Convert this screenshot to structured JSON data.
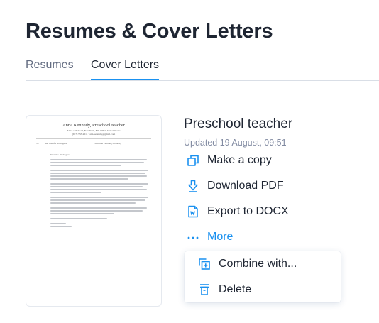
{
  "page": {
    "title": "Resumes & Cover Letters"
  },
  "tabs": [
    {
      "label": "Resumes",
      "active": false
    },
    {
      "label": "Cover Letters",
      "active": true
    }
  ],
  "document": {
    "title": "Preschool teacher",
    "updated": "Updated 19 August, 09:51",
    "preview": {
      "name": "Anna Kennedy, Preschool teacher",
      "contact_line1": "348 Loeth Road, New York, NY 10001, United States",
      "contact_line2": "(917) 555-2211 · ann.kennedy@gmail.com",
      "meta1": "To",
      "meta2": "Ms. Jennifer Rodriguez",
      "meta3": "Sunshine Learning Academy",
      "salutation": "Dear Ms. Rodriguez"
    }
  },
  "actions": [
    {
      "label": "Make a copy",
      "icon": "copy-icon"
    },
    {
      "label": "Download PDF",
      "icon": "download-icon"
    },
    {
      "label": "Export to DOCX",
      "icon": "word-doc-icon"
    },
    {
      "label": "More",
      "icon": "more-dots-icon"
    }
  ],
  "more_menu": [
    {
      "label": "Combine with...",
      "icon": "combine-icon"
    },
    {
      "label": "Delete",
      "icon": "trash-icon"
    }
  ],
  "colors": {
    "accent": "#1a91f0",
    "text": "#1e2532",
    "muted": "#828ba2",
    "border": "#d9dee6"
  }
}
